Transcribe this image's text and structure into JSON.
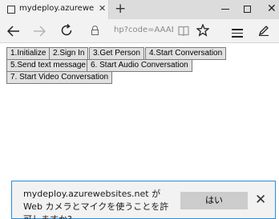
{
  "browser": {
    "tab_title": "mydeploy.azurewebsites",
    "tab_close_glyph": "✕",
    "new_tab_glyph": "+",
    "window_close_glyph": "✕",
    "url_text": "hp?code=AAABA",
    "icons": [
      "back-icon",
      "forward-icon",
      "refresh-icon",
      "lock-icon",
      "reading-view-icon",
      "favorite-star-icon",
      "hub-icon",
      "web-note-icon"
    ]
  },
  "page": {
    "buttons": [
      {
        "label": "1.Initialize"
      },
      {
        "label": "2.Sign In"
      },
      {
        "label": "3.Get Person"
      },
      {
        "label": "4.Start Conversation"
      },
      {
        "label": "5.Send text message"
      },
      {
        "label": "6. Start Audio Conversation"
      },
      {
        "label": "7. Start Video Conversation"
      }
    ]
  },
  "notification": {
    "message": "mydeploy.azurewebsites.net が Web カメラとマイクを使うことを許可しますか?",
    "allow_label": "はい",
    "close_glyph": "✕",
    "border_color": "#2b8ad6"
  }
}
